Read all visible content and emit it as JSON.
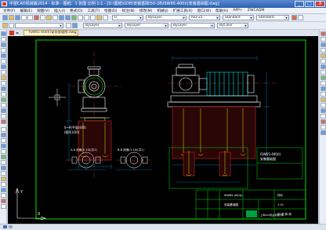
{
  "window": {
    "title": "中望CAD机械版2014 - 标准 - 图纸：1 张图 比例 1:1 - [D:\\图纸\\GDB\\安装基础\\50-28\\ISW65-400(I)安装基础图.dwg]",
    "minimize": "_",
    "maximize": "□",
    "close": "X"
  },
  "menu": [
    "文件(F)",
    "编辑(E)",
    "视图(V)",
    "插入(I)",
    "格式(O)",
    "工具(T)",
    "绘图(D)",
    "标注(N)",
    "修改(M)",
    "机械(J)",
    "扩展工具(X)",
    "窗口(W)",
    "帮助(H)",
    "APP+",
    "ZWCADM"
  ],
  "toolbar2": {
    "layer_combo": "0",
    "color_combo": "ByLayer",
    "style_combo": "Standard",
    "scale_combo": "ISO-25",
    "dim_combo": "Standard",
    "table_combo": "Standard"
  },
  "toolbar3": {
    "layer_state_combo": "",
    "color_combo": "ByLayer",
    "linetype_combo": "ByLayer",
    "lineweight_combo": "ByLayer",
    "plotstyle_combo": "ByColor"
  },
  "doc_tab": {
    "label": "ISW65-400(I)安装基础图.dwg",
    "close": "×"
  },
  "drawing": {
    "left_note_1": "0~9(平面)(00)",
    "left_note_2": "(图号)(00)",
    "mid_note_1": "A-A 剖面(1:10)(共1)",
    "mid_note_2": "B-B 剖面(1:10)(共1)",
    "axis_y": "Y",
    "axis_x": "X",
    "title_block": {
      "drawing_no": "ISW65-400(I)",
      "drawing_name": "安装基础图",
      "company": "上海XXX泵业有限公司",
      "material_label": "材料",
      "scale_label": "1:10",
      "sheet_label": "共1张 第1张"
    }
  }
}
